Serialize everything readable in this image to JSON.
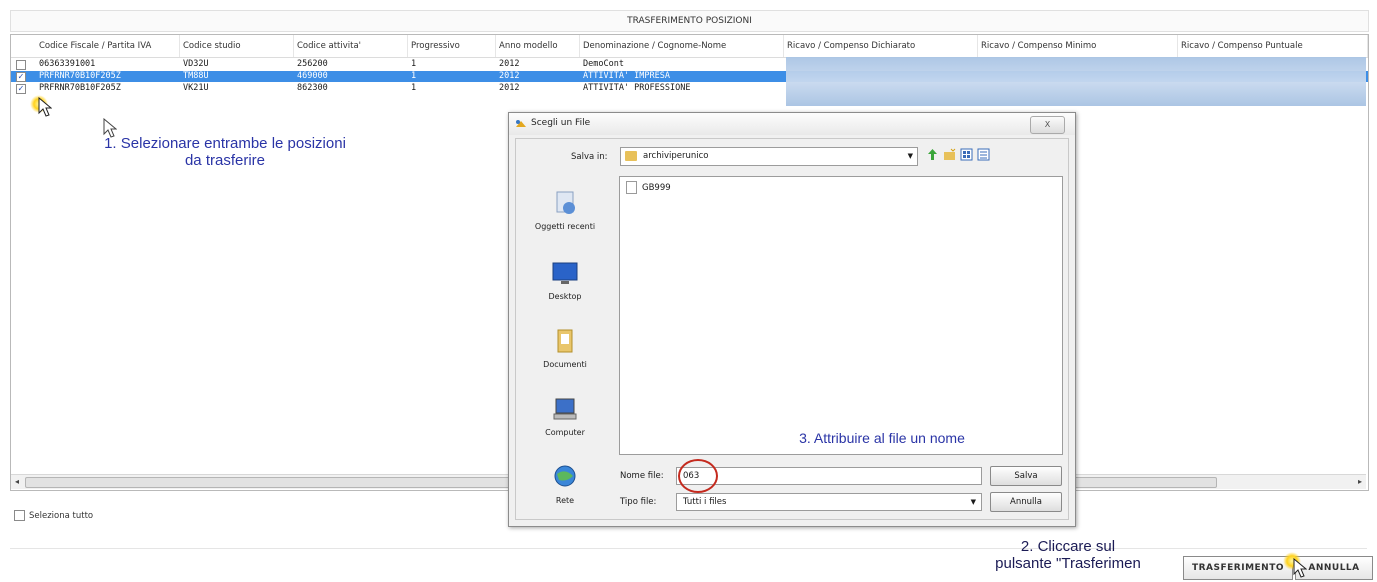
{
  "panel": {
    "title": "TRASFERIMENTO POSIZIONI"
  },
  "grid": {
    "columns": [
      "Codice Fiscale / Partita IVA",
      "Codice studio",
      "Codice attivita'",
      "Progressivo",
      "Anno modello",
      "Denominazione / Cognome-Nome",
      "Ricavo / Compenso Dichiarato",
      "Ricavo / Compenso Minimo",
      "Ricavo / Compenso Puntuale"
    ],
    "rows": [
      {
        "checked": false,
        "selected": false,
        "cells": [
          "06363391001",
          "VD32U",
          "256200",
          "1",
          "2012",
          "DemoCont"
        ]
      },
      {
        "checked": true,
        "selected": true,
        "cells": [
          "PRFRNR70B10F205Z",
          "TM88U",
          "469000",
          "1",
          "2012",
          "ATTIVITA' IMPRESA"
        ]
      },
      {
        "checked": true,
        "selected": false,
        "cells": [
          "PRFRNR70B10F205Z",
          "VK21U",
          "862300",
          "1",
          "2012",
          "ATTIVITA' PROFESSIONE"
        ]
      }
    ]
  },
  "select_all": {
    "label": "Seleziona tutto"
  },
  "buttons": {
    "transfer": "TRASFERIMENTO",
    "cancel": "ANNULLA"
  },
  "notes": {
    "step1_line1": "1. Selezionare entrambe le posizioni",
    "step1_line2": "da trasferire",
    "step2_line1": "2. Cliccare sul",
    "step2_line2": "pulsante \"Trasferimen",
    "step3": "3. Attribuire al file un nome"
  },
  "dialog": {
    "title": "Scegli un File",
    "close_label": "X",
    "save_in_label": "Salva in:",
    "save_in_value": "archiviperunico",
    "places": [
      "Oggetti recenti",
      "Desktop",
      "Documenti",
      "Computer",
      "Rete"
    ],
    "files": [
      "GB999"
    ],
    "filename_label": "Nome file:",
    "filename_value": "063",
    "filetype_label": "Tipo file:",
    "filetype_value": "Tutti i files",
    "save_button": "Salva",
    "cancel_button": "Annulla"
  }
}
